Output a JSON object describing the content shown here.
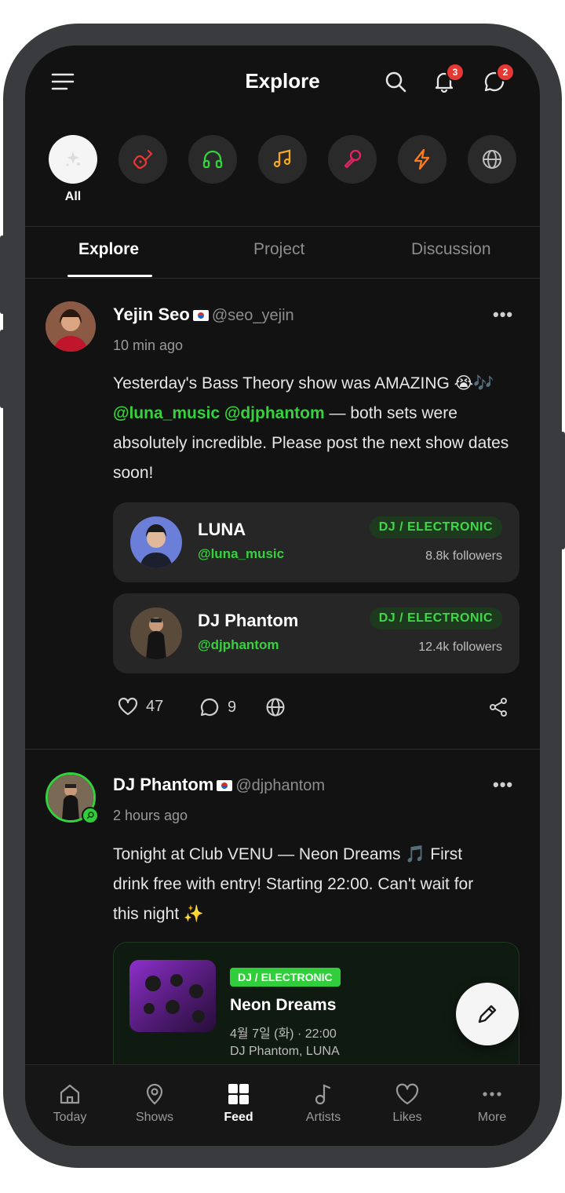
{
  "header": {
    "title": "Explore",
    "notifications_count": "3",
    "messages_count": "2"
  },
  "genres": [
    {
      "icon": "sparkle-icon",
      "label": "All",
      "color": "#ffffff"
    },
    {
      "icon": "guitar-icon",
      "label": "",
      "color": "#e53935"
    },
    {
      "icon": "headphones-icon",
      "label": "",
      "color": "#34d33d"
    },
    {
      "icon": "music-note-icon",
      "label": "",
      "color": "#f5a623"
    },
    {
      "icon": "microphone-icon",
      "label": "",
      "color": "#e91e63"
    },
    {
      "icon": "lightning-icon",
      "label": "",
      "color": "#ff7a1a"
    },
    {
      "icon": "globe-icon",
      "label": "",
      "color": "#bdbdbd"
    }
  ],
  "tabs": [
    "Explore",
    "Project",
    "Discussion"
  ],
  "posts": [
    {
      "name": "Yejin Seo",
      "handle": "@seo_yejin",
      "time": "10 min ago",
      "text_1": "Yesterday's Bass Theory show was AMAZING 😭🎶 ",
      "mention_1": "@luna_music",
      "mention_2": "@djphantom",
      "text_2": " — both sets were absolutely incredible. Please post the next show dates soon!",
      "likes": "47",
      "comments": "9",
      "tagged_artists": [
        {
          "name": "LUNA",
          "handle": "@luna_music",
          "genre": "DJ / ELECTRONIC",
          "followers": "8.8k followers"
        },
        {
          "name": "DJ Phantom",
          "handle": "@djphantom",
          "genre": "DJ / ELECTRONIC",
          "followers": "12.4k followers"
        }
      ]
    },
    {
      "name": "DJ Phantom",
      "handle": "@djphantom",
      "time": "2 hours ago",
      "text": "Tonight at Club VENU — Neon Dreams 🎵 First drink free with entry! Starting 22:00. Can't wait for this night ✨",
      "event": {
        "genre": "DJ / ELECTRONIC",
        "title": "Neon Dreams",
        "date": "4월 7일 (화) · 22:00",
        "lineup": "DJ Phantom, LUNA"
      }
    }
  ],
  "bottom_nav": [
    {
      "label": "Today",
      "icon": "home-icon"
    },
    {
      "label": "Shows",
      "icon": "location-pin-icon"
    },
    {
      "label": "Feed",
      "icon": "grid-icon",
      "active": true
    },
    {
      "label": "Artists",
      "icon": "music-note-icon"
    },
    {
      "label": "Likes",
      "icon": "heart-icon"
    },
    {
      "label": "More",
      "icon": "more-icon"
    }
  ],
  "colors": {
    "accent": "#34d33d",
    "badge": "#e53935",
    "background": "#121212"
  }
}
